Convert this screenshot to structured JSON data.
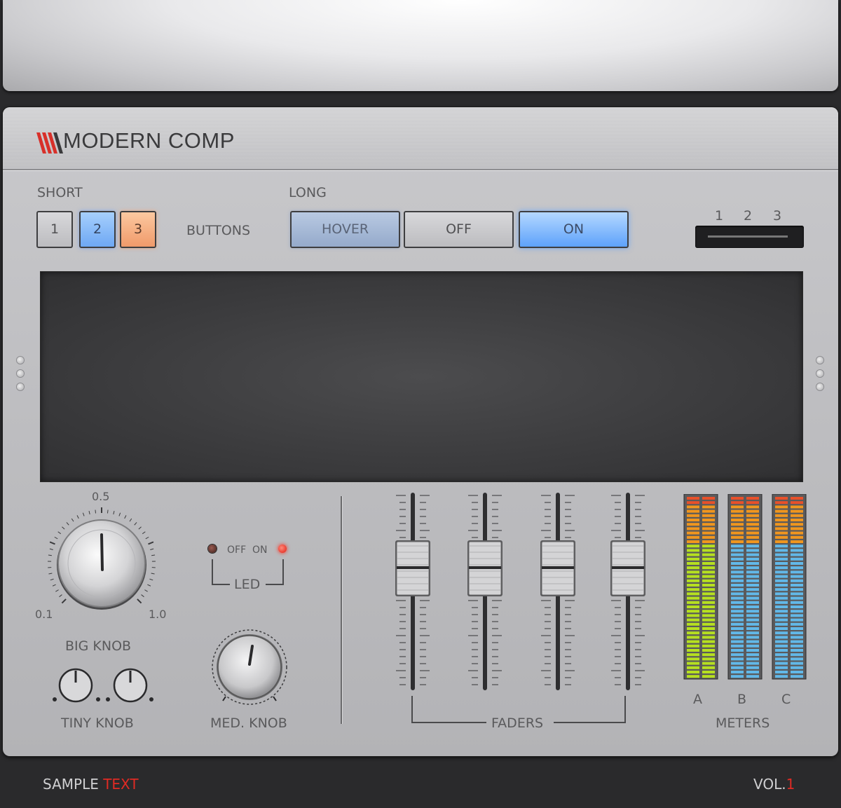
{
  "header": {
    "title": "MODERN COMP"
  },
  "buttons": {
    "short_label": "SHORT",
    "long_label": "LONG",
    "short": [
      "1",
      "2",
      "3"
    ],
    "buttons_label": "BUTTONS",
    "long": [
      "HOVER",
      "OFF",
      "ON"
    ]
  },
  "selector": {
    "labels": [
      "1",
      "2",
      "3"
    ]
  },
  "big_knob": {
    "label": "BIG KNOB",
    "min": "0.1",
    "mid": "0.5",
    "max": "1.0"
  },
  "led": {
    "off_label": "OFF",
    "on_label": "ON",
    "label": "LED"
  },
  "tiny_knob": {
    "label": "TINY KNOB"
  },
  "med_knob": {
    "label": "MED. KNOB"
  },
  "faders": {
    "label": "FADERS",
    "count": 4
  },
  "meters": {
    "label": "METERS",
    "channels": [
      "A",
      "B",
      "C"
    ]
  },
  "footer": {
    "left_a": "SAMPLE",
    "left_b": "TEXT",
    "right_a": "VOL.",
    "right_b": "1"
  },
  "colors": {
    "accent_red": "#e02a24",
    "blue": "#6ea8f4",
    "orange": "#f09a6a",
    "meter_green": "#b6e020",
    "meter_blue": "#62b8e8",
    "meter_orange": "#f0961e",
    "meter_red": "#e8502a"
  }
}
